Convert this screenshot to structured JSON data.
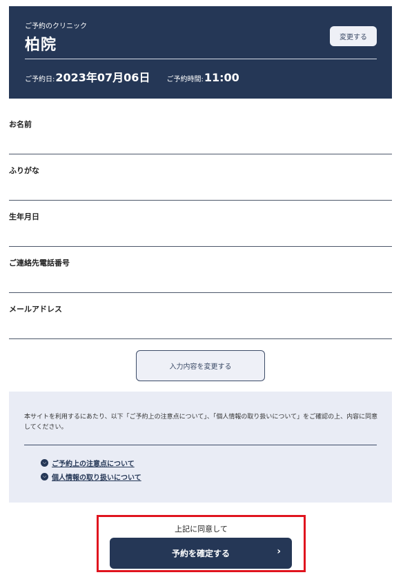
{
  "clinic": {
    "caption": "ご予約のクリニック",
    "name": "柏院",
    "change_label": "変更する",
    "date_label": "ご予約日:",
    "date_value": "2023年07月06日",
    "time_label": "ご予約時間:",
    "time_value": "11:00"
  },
  "form": {
    "fields": [
      {
        "label": "お名前",
        "value": ""
      },
      {
        "label": "ふりがな",
        "value": ""
      },
      {
        "label": "生年月日",
        "value": ""
      },
      {
        "label": "ご連絡先電話番号",
        "value": ""
      },
      {
        "label": "メールアドレス",
        "value": ""
      }
    ],
    "edit_label": "入力内容を変更する"
  },
  "notice": {
    "text": "本サイトを利用するにあたり、以下「ご予約上の注意点について」、「個人情報の取り扱いについて」をご確認の上、内容に同意してください。",
    "links": [
      {
        "label": "ご予約上の注意点について",
        "icon": "chevron-down-icon"
      },
      {
        "label": "個人情報の取り扱いについて",
        "icon": "chevron-down-icon"
      }
    ]
  },
  "confirm": {
    "agree_text": "上記に同意して",
    "button_label": "予約を確定する",
    "icon": "chevron-right-icon"
  },
  "colors": {
    "navy": "#253756",
    "highlight": "#e0141e",
    "notice_bg": "#e9ecf5"
  }
}
